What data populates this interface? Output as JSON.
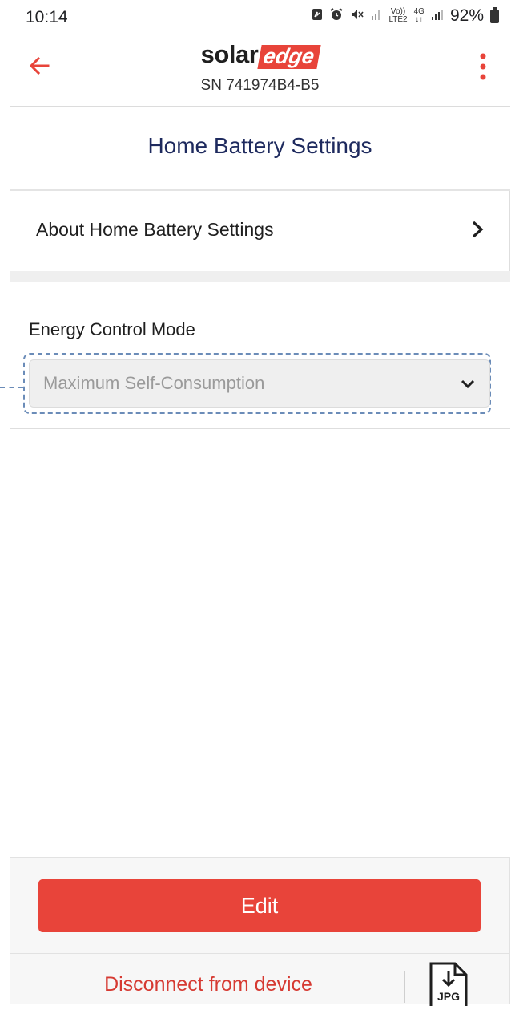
{
  "status_bar": {
    "time": "10:14",
    "volte_top": "Vo))",
    "volte_bottom": "LTE2",
    "network_type": "4G",
    "battery_percent": "92%"
  },
  "header": {
    "logo_solar": "solar",
    "logo_edge": "edge",
    "serial_number": "SN 741974B4-B5",
    "accent_color": "#e8443a"
  },
  "page": {
    "title": "Home Battery Settings"
  },
  "about": {
    "label": "About Home Battery Settings"
  },
  "energy_control": {
    "label": "Energy Control Mode",
    "selected_value": "Maximum Self-Consumption"
  },
  "actions": {
    "edit_label": "Edit",
    "disconnect_label": "Disconnect from device",
    "export_label": "JPG"
  }
}
